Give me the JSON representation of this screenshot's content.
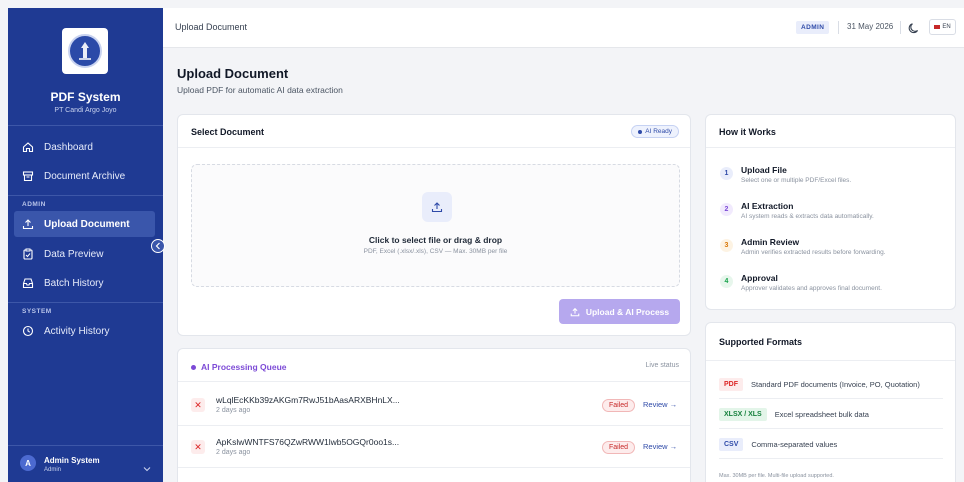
{
  "brand": {
    "name": "PDF System",
    "company": "PT Candi Argo Joyo"
  },
  "sidebar": {
    "items_main": [
      {
        "label": "Dashboard",
        "icon": "home-icon"
      },
      {
        "label": "Document Archive",
        "icon": "archive-icon"
      }
    ],
    "section_admin": "ADMIN",
    "items_admin": [
      {
        "label": "Upload Document",
        "icon": "upload-icon",
        "active": true
      },
      {
        "label": "Data Preview",
        "icon": "clipboard-icon"
      },
      {
        "label": "Batch History",
        "icon": "tray-icon"
      }
    ],
    "section_system": "SYSTEM",
    "items_system": [
      {
        "label": "Activity History",
        "icon": "clock-icon"
      }
    ],
    "user": {
      "initial": "A",
      "name": "Admin System",
      "role": "Admin"
    }
  },
  "topbar": {
    "title": "Upload Document",
    "role_badge": "ADMIN",
    "date": "31 May 2026",
    "lang": "EN"
  },
  "page": {
    "title": "Upload Document",
    "subtitle": "Upload PDF for automatic AI data extraction"
  },
  "select_card": {
    "title": "Select Document",
    "status": "AI Ready",
    "dropzone_title": "Click to select file or drag & drop",
    "dropzone_hint": "PDF, Excel (.xlsx/.xls), CSV — Max. 30MB per file",
    "upload_button": "Upload & AI Process"
  },
  "queue": {
    "title": "AI Processing Queue",
    "live_label": "Live status",
    "rows": [
      {
        "name": "wLqlEcKKb39zAKGm7RwJ51bAasARXBHnLX...",
        "time": "2 days ago",
        "status": "Failed",
        "action": "Review →"
      },
      {
        "name": "ApKslwWNTFS76QZwRWW1lwb5OGQr0oo1s...",
        "time": "2 days ago",
        "status": "Failed",
        "action": "Review →"
      }
    ]
  },
  "how_it_works": {
    "title": "How it Works",
    "steps": [
      {
        "num": "1",
        "title": "Upload File",
        "desc": "Select one or multiple PDF/Excel files.",
        "color": "#2e4aa8",
        "bg": "#e9edfb"
      },
      {
        "num": "2",
        "title": "AI Extraction",
        "desc": "AI system reads & extracts data automatically.",
        "color": "#7c4ad6",
        "bg": "#f1eafd"
      },
      {
        "num": "3",
        "title": "Admin Review",
        "desc": "Admin verifies extracted results before forwarding.",
        "color": "#d97706",
        "bg": "#fdf3e3"
      },
      {
        "num": "4",
        "title": "Approval",
        "desc": "Approver validates and approves final document.",
        "color": "#16a34a",
        "bg": "#e7f6ec"
      }
    ]
  },
  "formats": {
    "title": "Supported Formats",
    "rows": [
      {
        "tag": "PDF",
        "desc": "Standard PDF documents (Invoice, PO, Quotation)",
        "color": "#dc2626",
        "bg": "#fdecec"
      },
      {
        "tag": "XLSX / XLS",
        "desc": "Excel spreadsheet bulk data",
        "color": "#15803d",
        "bg": "#e3f5e9"
      },
      {
        "tag": "CSV",
        "desc": "Comma-separated values",
        "color": "#2e4aa8",
        "bg": "#e9edfb"
      }
    ],
    "note": "Max. 30MB per file. Multi-file upload supported."
  }
}
